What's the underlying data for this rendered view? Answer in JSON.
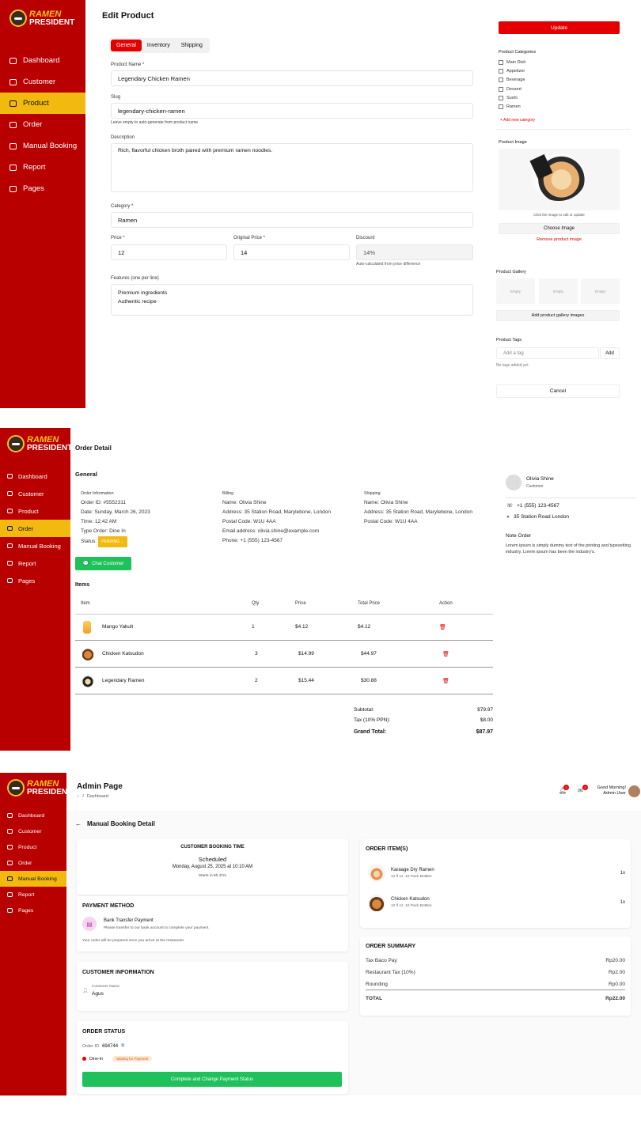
{
  "brand": {
    "line1": "RAMEN",
    "line2": "PRESIDENT"
  },
  "nav": {
    "p1": [
      "Dashboard",
      "Customer",
      "Product",
      "Order",
      "Manual Booking",
      "Report",
      "Pages"
    ],
    "p2": [
      "Dashboard",
      "Customer",
      "Product",
      "Order",
      "Manual Booking",
      "Report",
      "Pages"
    ],
    "p3": [
      "Dashboard",
      "Customer",
      "Product",
      "Order",
      "Manual Booking",
      "Report",
      "Pages"
    ]
  },
  "edit_product": {
    "title": "Edit Product",
    "tabs": [
      "General",
      "Inventory",
      "Shipping"
    ],
    "product_name_label": "Product Name *",
    "product_name": "Legendary Chicken Ramen",
    "slug_label": "Slug",
    "slug": "legendary-chicken-ramen",
    "slug_hint": "Leave empty to auto-generate from product name",
    "description_label": "Description",
    "description": "Rich, flavorful chicken broth paired with premium ramen noodles.",
    "category_label": "Category *",
    "category": "Ramen",
    "price_label": "Price *",
    "price": "12",
    "original_price_label": "Original Price *",
    "original_price": "14",
    "discount_label": "Discount",
    "discount": "14%",
    "discount_hint": "Auto-calculated from price difference",
    "features_label": "Features (one per line)",
    "features": [
      "Premium ingredients",
      "Authentic recipe"
    ],
    "update_label": "Update",
    "categories_title": "Product Categories",
    "categories": [
      "Main Dish",
      "Appetizer",
      "Beverage",
      "Dessert",
      "Sushi",
      "Ramen"
    ],
    "add_category": "+ Add new category",
    "image_title": "Product Image",
    "image_hint": "Click the image to edit or update",
    "choose_image": "Choose Image",
    "remove_image": "Remove product image",
    "gallery_title": "Product Gallery",
    "gallery_slots": [
      "Empty",
      "Empty",
      "Empty"
    ],
    "add_gallery": "Add product gallery images",
    "tags_title": "Product Tags",
    "tag_placeholder": "Add a tag",
    "tag_add": "Add",
    "tags_empty": "No tags added yet",
    "cancel": "Cancel"
  },
  "order_detail": {
    "title": "Order Detail",
    "general": "General",
    "info_title": "Order Information",
    "order_id": "Order ID: #5552311",
    "date": "Date: Sunday, March 26, 2023",
    "time": "Time: 12:42 AM",
    "type": "Type Order: Dine In",
    "status_label": "Status:",
    "status": "PENDING",
    "billing_title": "Billing",
    "billing": [
      "Name: Olivia Shine",
      "Address: 35 Station Road, Marylebone, London",
      "Postal Code: W1U 4AA",
      "Email address: olivia.shine@example.com",
      "Phone: +1 (555) 123-4567"
    ],
    "shipping_title": "Shipping",
    "shipping": [
      "Name: Olivia Shine",
      "Address: 35 Station Road, Marylebone, London",
      "Postal Code: W1U 4AA"
    ],
    "chat_button": "Chat Customer",
    "items_title": "Items",
    "columns": [
      "Item",
      "Qty",
      "Price",
      "Total Price",
      "Action"
    ],
    "items": [
      {
        "name": "Mango Yakult",
        "qty": "1",
        "price": "$4.12",
        "total": "$4.12"
      },
      {
        "name": "Chicken Katsudon",
        "qty": "3",
        "price": "$14.99",
        "total": "$44.97"
      },
      {
        "name": "Legendary Ramen",
        "qty": "2",
        "price": "$15.44",
        "total": "$30.88"
      }
    ],
    "subtotal_label": "Subtotal:",
    "subtotal": "$79.97",
    "tax_label": "Tax (10% PPN):",
    "tax": "$8.00",
    "grand_label": "Grand Total:",
    "grand": "$87.97",
    "customer_name": "Olivia Shine",
    "customer_role": "Customer",
    "customer_phone": "+1 (555) 123-4567",
    "customer_address": "35 Station Road London",
    "note_title": "Note Order",
    "note": "Lorem ipsum is simply dummy text of the printing and typesetting industry. Lorem ipsum has been the industry's."
  },
  "admin": {
    "title": "Admin Page",
    "breadcrumb": "Dashboard",
    "greeting": "Good Morning!",
    "user": "Admin User",
    "notif_count": "3",
    "msg_count": "2",
    "page_title": "Manual Booking Detail",
    "booking_time_title": "CUSTOMER BOOKING TIME",
    "booking_status": "Scheduled",
    "booking_date": "Monday, August 25, 2025 at 10:10 AM",
    "booking_starts": "Starts in 6h 47m",
    "payment_title": "PAYMENT METHOD",
    "payment_name": "Bank Transfer Payment",
    "payment_desc": "Please transfer to our bank account to complete your payment.",
    "payment_note": "Your order will be prepared once you arrive at the restaurant.",
    "customer_title": "CUSTOMER INFORMATION",
    "customer_label": "Customer Name",
    "customer_name": "Agus",
    "status_title": "ORDER STATUS",
    "order_id_label": "Order ID",
    "order_id": "694744",
    "dine_in": "Dine-In",
    "waiting": "Waiting for Payment",
    "complete_button": "Complete and Change Payment Status",
    "items_title": "ORDER ITEM(S)",
    "items": [
      {
        "name": "Karaage Dry Ramen",
        "desc": "12 fl oz. 10 Pack Bottles",
        "qty": "1x"
      },
      {
        "name": "Chicken Katsudon",
        "desc": "12 fl oz. 10 Pack Bottles",
        "qty": "1x"
      }
    ],
    "summary_title": "ORDER SUMMARY",
    "summary": [
      {
        "label": "Tax Baco Pay",
        "value": "Rp20.00"
      },
      {
        "label": "Restaurant Tax (10%)",
        "value": "Rp2.00"
      },
      {
        "label": "Rounding",
        "value": "Rp0.00"
      }
    ],
    "total_label": "TOTAL",
    "total": "Rp22.00"
  }
}
